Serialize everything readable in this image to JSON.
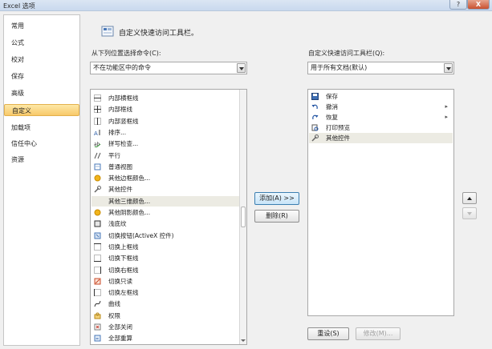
{
  "window": {
    "title": "Excel 选项",
    "help_label": "?",
    "close_label": "X"
  },
  "sidebar": {
    "items": [
      {
        "label": "常用"
      },
      {
        "label": "公式"
      },
      {
        "label": "校对"
      },
      {
        "label": "保存"
      },
      {
        "label": "高级"
      },
      {
        "label": "自定义"
      },
      {
        "label": "加载项"
      },
      {
        "label": "信任中心"
      },
      {
        "label": "资源"
      }
    ],
    "selected": "自定义"
  },
  "main": {
    "header": "自定义快速访问工具栏。",
    "left": {
      "label": "从下列位置选择命令(C):",
      "combo_value": "不在功能区中的命令",
      "commands": [
        {
          "label": "内部横框线",
          "icon": "border-h-icon"
        },
        {
          "label": "内部框线",
          "icon": "border-inner-icon"
        },
        {
          "label": "内部竖框线",
          "icon": "border-v-icon"
        },
        {
          "label": "排序...",
          "icon": "sort-icon"
        },
        {
          "label": "拼写检查...",
          "icon": "spellcheck-icon"
        },
        {
          "label": "平行",
          "icon": "parallel-icon"
        },
        {
          "label": "普通视图",
          "icon": "normal-view-icon"
        },
        {
          "label": "其他边框颜色...",
          "icon": "color-circle-icon"
        },
        {
          "label": "其他控件",
          "icon": "tools-icon"
        },
        {
          "label": "其他三维颜色...",
          "icon": "blank-icon"
        },
        {
          "label": "其他阴影颜色...",
          "icon": "color-circle-icon"
        },
        {
          "label": "浅底纹",
          "icon": "shade-icon"
        },
        {
          "label": "切换按钮(ActiveX 控件)",
          "icon": "toggle-icon"
        },
        {
          "label": "切换上框线",
          "icon": "border-top-icon"
        },
        {
          "label": "切换下框线",
          "icon": "border-bottom-icon"
        },
        {
          "label": "切换右框线",
          "icon": "border-right-icon"
        },
        {
          "label": "切换只读",
          "icon": "readonly-icon"
        },
        {
          "label": "切换左框线",
          "icon": "border-left-icon"
        },
        {
          "label": "曲线",
          "icon": "curve-icon"
        },
        {
          "label": "权限",
          "icon": "permission-icon"
        },
        {
          "label": "全部关闭",
          "icon": "close-all-icon"
        },
        {
          "label": "全部重算",
          "icon": "recalc-icon"
        }
      ],
      "selected_index": 9
    },
    "add_button": "添加(A) >>",
    "remove_button": "删除(R)",
    "right": {
      "label": "自定义快速访问工具栏(Q):",
      "combo_value": "用于所有文档(默认)",
      "items": [
        {
          "label": "保存",
          "icon": "save-icon",
          "arrow": ""
        },
        {
          "label": "撤消",
          "icon": "undo-icon",
          "arrow": "▸"
        },
        {
          "label": "恢复",
          "icon": "redo-icon",
          "arrow": "▸"
        },
        {
          "label": "打印预览",
          "icon": "print-preview-icon",
          "arrow": ""
        },
        {
          "label": "其他控件",
          "icon": "tools-icon",
          "arrow": ""
        }
      ],
      "selected_index": 4
    },
    "reset_button": "重设(S)",
    "modify_button": "修改(M)..."
  }
}
